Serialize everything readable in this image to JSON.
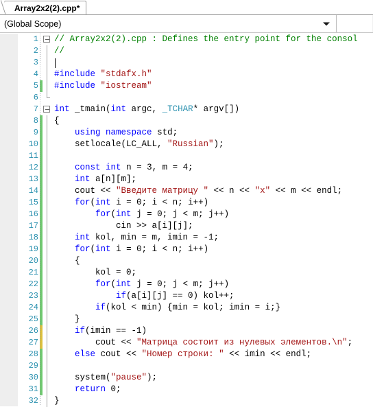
{
  "window": {
    "tab": {
      "label": "Array2x2(2).cpp*",
      "modified": true
    }
  },
  "navbar": {
    "scope_value": "(Global Scope)",
    "scope_placeholder": "(Global Scope)",
    "dropdown_icon": "chevron-down-icon"
  },
  "colors": {
    "comment": "#008000",
    "keyword": "#0000ff",
    "string": "#a31515",
    "type": "#2b91af",
    "line_number": "#2b91af",
    "margin_saved": "#6fc96f",
    "margin_unsaved": "#dcc03c",
    "editor_bg": "#ffffff",
    "left_pad_bg": "#eeeeee",
    "navbar_bg": "#f1f1f1"
  },
  "editor": {
    "caret_line": 3,
    "lines": [
      {
        "n": 1,
        "margin": "none",
        "outline": "box",
        "tokens": [
          {
            "t": "// Array2x2(2).cpp : Defines the entry point for the consol",
            "c": "cmt"
          }
        ]
      },
      {
        "n": 2,
        "margin": "none",
        "outline": "line",
        "tokens": [
          {
            "t": "//",
            "c": "cmt"
          }
        ]
      },
      {
        "n": 3,
        "margin": "none",
        "outline": "line",
        "tokens": [
          {
            "t": "",
            "c": "pln"
          }
        ]
      },
      {
        "n": 4,
        "margin": "none",
        "outline": "line",
        "tokens": [
          {
            "t": "#include ",
            "c": "pre"
          },
          {
            "t": "\"stdafx.h\"",
            "c": "str"
          }
        ]
      },
      {
        "n": 5,
        "margin": "saved",
        "outline": "line",
        "tokens": [
          {
            "t": "#include ",
            "c": "pre"
          },
          {
            "t": "\"iostream\"",
            "c": "str"
          }
        ]
      },
      {
        "n": 6,
        "margin": "none",
        "outline": "end",
        "tokens": [
          {
            "t": "",
            "c": "pln"
          }
        ]
      },
      {
        "n": 7,
        "margin": "none",
        "outline": "box",
        "tokens": [
          {
            "t": "int",
            "c": "kw"
          },
          {
            "t": " _tmain(",
            "c": "pln"
          },
          {
            "t": "int",
            "c": "kw"
          },
          {
            "t": " argc, ",
            "c": "pln"
          },
          {
            "t": "_TCHAR",
            "c": "typ"
          },
          {
            "t": "* argv[])",
            "c": "pln"
          }
        ]
      },
      {
        "n": 8,
        "margin": "saved",
        "outline": "line",
        "tokens": [
          {
            "t": "{",
            "c": "pln"
          }
        ]
      },
      {
        "n": 9,
        "margin": "saved",
        "outline": "line",
        "tokens": [
          {
            "t": "    ",
            "c": "pln"
          },
          {
            "t": "using",
            "c": "kw"
          },
          {
            "t": " ",
            "c": "pln"
          },
          {
            "t": "namespace",
            "c": "kw"
          },
          {
            "t": " std;",
            "c": "pln"
          }
        ]
      },
      {
        "n": 10,
        "margin": "saved",
        "outline": "line",
        "tokens": [
          {
            "t": "    setlocale(LC_ALL, ",
            "c": "pln"
          },
          {
            "t": "\"Russian\"",
            "c": "str"
          },
          {
            "t": ");",
            "c": "pln"
          }
        ]
      },
      {
        "n": 11,
        "margin": "saved",
        "outline": "line",
        "tokens": [
          {
            "t": "",
            "c": "pln"
          }
        ]
      },
      {
        "n": 12,
        "margin": "saved",
        "outline": "line",
        "tokens": [
          {
            "t": "    ",
            "c": "pln"
          },
          {
            "t": "const",
            "c": "kw"
          },
          {
            "t": " ",
            "c": "pln"
          },
          {
            "t": "int",
            "c": "kw"
          },
          {
            "t": " n = 3, m = 4;",
            "c": "pln"
          }
        ]
      },
      {
        "n": 13,
        "margin": "saved",
        "outline": "line",
        "tokens": [
          {
            "t": "    ",
            "c": "pln"
          },
          {
            "t": "int",
            "c": "kw"
          },
          {
            "t": " a[n][m];",
            "c": "pln"
          }
        ]
      },
      {
        "n": 14,
        "margin": "saved",
        "outline": "line",
        "tokens": [
          {
            "t": "    cout << ",
            "c": "pln"
          },
          {
            "t": "\"Введите матрицу \"",
            "c": "str"
          },
          {
            "t": " << n << ",
            "c": "pln"
          },
          {
            "t": "\"x\"",
            "c": "str"
          },
          {
            "t": " << m << endl;",
            "c": "pln"
          }
        ]
      },
      {
        "n": 15,
        "margin": "saved",
        "outline": "line",
        "tokens": [
          {
            "t": "    ",
            "c": "pln"
          },
          {
            "t": "for",
            "c": "kw"
          },
          {
            "t": "(",
            "c": "pln"
          },
          {
            "t": "int",
            "c": "kw"
          },
          {
            "t": " i = 0; i < n; i++)",
            "c": "pln"
          }
        ]
      },
      {
        "n": 16,
        "margin": "saved",
        "outline": "line",
        "tokens": [
          {
            "t": "        ",
            "c": "pln"
          },
          {
            "t": "for",
            "c": "kw"
          },
          {
            "t": "(",
            "c": "pln"
          },
          {
            "t": "int",
            "c": "kw"
          },
          {
            "t": " j = 0; j < m; j++)",
            "c": "pln"
          }
        ]
      },
      {
        "n": 17,
        "margin": "saved",
        "outline": "line",
        "tokens": [
          {
            "t": "            cin >> a[i][j];",
            "c": "pln"
          }
        ]
      },
      {
        "n": 18,
        "margin": "saved",
        "outline": "line",
        "tokens": [
          {
            "t": "    ",
            "c": "pln"
          },
          {
            "t": "int",
            "c": "kw"
          },
          {
            "t": " kol, min = m, imin = -1;",
            "c": "pln"
          }
        ]
      },
      {
        "n": 19,
        "margin": "saved",
        "outline": "line",
        "tokens": [
          {
            "t": "    ",
            "c": "pln"
          },
          {
            "t": "for",
            "c": "kw"
          },
          {
            "t": "(",
            "c": "pln"
          },
          {
            "t": "int",
            "c": "kw"
          },
          {
            "t": " i = 0; i < n; i++)",
            "c": "pln"
          }
        ]
      },
      {
        "n": 20,
        "margin": "saved",
        "outline": "line",
        "tokens": [
          {
            "t": "    {",
            "c": "pln"
          }
        ]
      },
      {
        "n": 21,
        "margin": "saved",
        "outline": "line",
        "tokens": [
          {
            "t": "        kol = 0;",
            "c": "pln"
          }
        ]
      },
      {
        "n": 22,
        "margin": "saved",
        "outline": "line",
        "tokens": [
          {
            "t": "        ",
            "c": "pln"
          },
          {
            "t": "for",
            "c": "kw"
          },
          {
            "t": "(",
            "c": "pln"
          },
          {
            "t": "int",
            "c": "kw"
          },
          {
            "t": " j = 0; j < m; j++)",
            "c": "pln"
          }
        ]
      },
      {
        "n": 23,
        "margin": "saved",
        "outline": "line",
        "tokens": [
          {
            "t": "            ",
            "c": "pln"
          },
          {
            "t": "if",
            "c": "kw"
          },
          {
            "t": "(a[i][j] == 0) kol++;",
            "c": "pln"
          }
        ]
      },
      {
        "n": 24,
        "margin": "saved",
        "outline": "line",
        "tokens": [
          {
            "t": "        ",
            "c": "pln"
          },
          {
            "t": "if",
            "c": "kw"
          },
          {
            "t": "(kol < min) {min = kol; imin = i;}",
            "c": "pln"
          }
        ]
      },
      {
        "n": 25,
        "margin": "saved",
        "outline": "line",
        "tokens": [
          {
            "t": "    }",
            "c": "pln"
          }
        ]
      },
      {
        "n": 26,
        "margin": "unsaved",
        "outline": "line",
        "tokens": [
          {
            "t": "    ",
            "c": "pln"
          },
          {
            "t": "if",
            "c": "kw"
          },
          {
            "t": "(imin == -1)",
            "c": "pln"
          }
        ]
      },
      {
        "n": 27,
        "margin": "unsaved",
        "outline": "line",
        "tokens": [
          {
            "t": "        cout << ",
            "c": "pln"
          },
          {
            "t": "\"Матрица состоит из нулевых элементов.\\n\"",
            "c": "str"
          },
          {
            "t": ";",
            "c": "pln"
          }
        ]
      },
      {
        "n": 28,
        "margin": "saved",
        "outline": "line",
        "tokens": [
          {
            "t": "    ",
            "c": "pln"
          },
          {
            "t": "else",
            "c": "kw"
          },
          {
            "t": " cout << ",
            "c": "pln"
          },
          {
            "t": "\"Номер строки: \"",
            "c": "str"
          },
          {
            "t": " << imin << endl;",
            "c": "pln"
          }
        ]
      },
      {
        "n": 29,
        "margin": "saved",
        "outline": "line",
        "tokens": [
          {
            "t": "",
            "c": "pln"
          }
        ]
      },
      {
        "n": 30,
        "margin": "saved",
        "outline": "line",
        "tokens": [
          {
            "t": "    system(",
            "c": "pln"
          },
          {
            "t": "\"pause\"",
            "c": "str"
          },
          {
            "t": ");",
            "c": "pln"
          }
        ]
      },
      {
        "n": 31,
        "margin": "saved",
        "outline": "line",
        "tokens": [
          {
            "t": "    ",
            "c": "pln"
          },
          {
            "t": "return",
            "c": "kw"
          },
          {
            "t": " 0;",
            "c": "pln"
          }
        ]
      },
      {
        "n": 32,
        "margin": "none",
        "outline": "line",
        "tokens": [
          {
            "t": "}",
            "c": "pln"
          }
        ]
      }
    ]
  }
}
